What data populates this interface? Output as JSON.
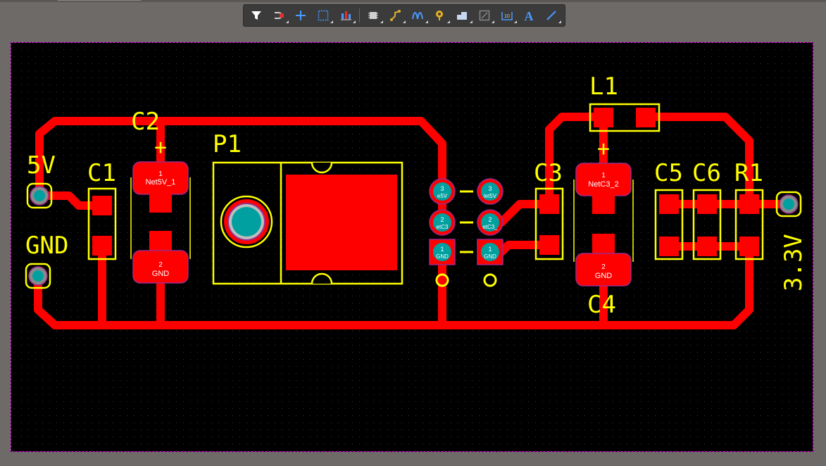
{
  "colors": {
    "background": "#6d6a67",
    "board": "#000000",
    "outline": "#ff00ff",
    "copper": "#ff0000",
    "silkscreen": "#ffff00",
    "pad_hole": "#00a0a0",
    "pad_text": "#ffffff"
  },
  "toolbar": {
    "tools": [
      {
        "name": "filter-icon"
      },
      {
        "name": "route-select-icon"
      },
      {
        "name": "crosshair-icon"
      },
      {
        "name": "select-rect-icon"
      },
      {
        "name": "align-icon"
      },
      {
        "name": "component-icon"
      },
      {
        "name": "route-track-icon"
      },
      {
        "name": "diff-pair-icon"
      },
      {
        "name": "via-icon"
      },
      {
        "name": "polygon-icon"
      },
      {
        "name": "region-icon"
      },
      {
        "name": "dimension-icon"
      },
      {
        "name": "text-icon"
      },
      {
        "name": "line-icon"
      }
    ],
    "text_tool_glyph": "A"
  },
  "pcb": {
    "designators": {
      "c1": "C1",
      "c2": "C2",
      "c3": "C3",
      "c4": "C4",
      "c5": "C5",
      "c6": "C6",
      "r1": "R1",
      "l1": "L1",
      "p1": "P1"
    },
    "labels": {
      "v5": "5V",
      "gnd": "GND",
      "v33": "3.3V"
    },
    "polarity": {
      "c2": "+",
      "c4": "+"
    },
    "pads": {
      "c2_1_num": "1",
      "c2_1_net": "Net5V_1",
      "c2_2_num": "2",
      "c2_2_net": "GND",
      "c4_1_num": "1",
      "c4_1_net": "NetC3_2",
      "c4_2_num": "2",
      "c4_2_net": "GND",
      "u_l3_num": "3",
      "u_l3_net": "e5V",
      "u_r3_num": "3",
      "u_r3_net": "let5V",
      "u_l2_num": "2",
      "u_l2_net": "etC3",
      "u_r2_num": "2",
      "u_r2_net": "etC3_",
      "u_l1_num": "1",
      "u_l1_net": "GND",
      "u_r1_num": "1",
      "u_r1_net": "GND"
    }
  }
}
